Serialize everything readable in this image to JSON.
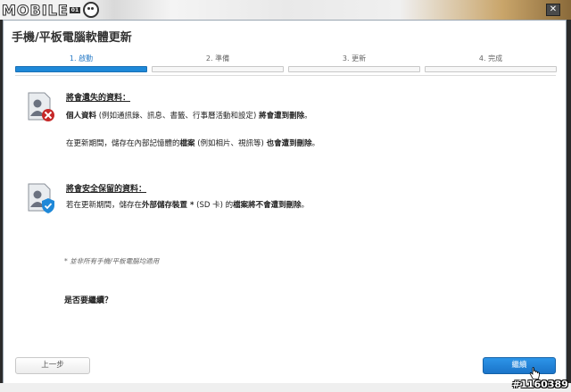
{
  "site": {
    "logo_text": "MOBILE",
    "logo_sub": "01",
    "watermark": "#1160389"
  },
  "dialog": {
    "title": "手機/平板電腦軟體更新",
    "close_label": "✕",
    "steps": [
      {
        "label": "1. 啟動",
        "active": true
      },
      {
        "label": "2. 準備",
        "active": false
      },
      {
        "label": "3. 更新",
        "active": false
      },
      {
        "label": "4. 完成",
        "active": false
      }
    ],
    "lost": {
      "heading": "將會遺失的資料：",
      "line1_pre": "個人資料",
      "line1_mid": " (例如通訊錄、訊息、書籤、行事曆活動和設定) ",
      "line1_post": "將會遭到刪除",
      "line1_end": "。",
      "line2_pre": "在更新期間，儲存在內部記憶體的",
      "line2_b1": "檔案",
      "line2_mid": " (例如相片、視訊等) ",
      "line2_b2": "也會遭到刪除",
      "line2_end": "。"
    },
    "safe": {
      "heading": "將會安全保留的資料：",
      "line1_pre": "若在更新期間，儲存在",
      "line1_b1": "外部儲存裝置 *",
      "line1_mid": " (SD 卡) 的",
      "line1_b2": "檔案將不會遭到刪除",
      "line1_end": "。"
    },
    "note": "* 並非所有手機/平板電腦均適用",
    "question": "是否要繼續？",
    "back_label": "上一步",
    "next_label": "繼續"
  },
  "colors": {
    "accent": "#1e88d8",
    "warning": "#c62828",
    "safe": "#1e88d8"
  },
  "icons": {
    "lost": "user-delete-icon",
    "safe": "user-check-icon",
    "close": "close-icon",
    "cursor": "hand-cursor-icon"
  }
}
